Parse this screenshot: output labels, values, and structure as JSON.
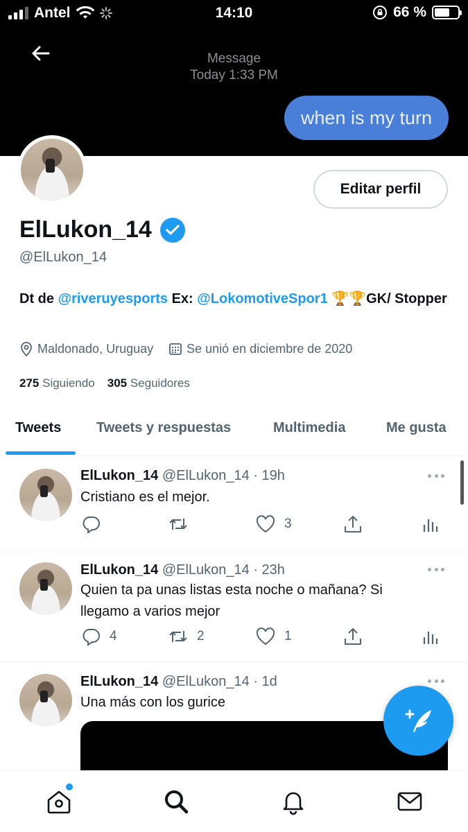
{
  "status_bar": {
    "carrier": "Antel",
    "time": "14:10",
    "battery": "66 %",
    "battery_level": 0.66
  },
  "banner": {
    "message_label": "Message",
    "message_time": "Today 1:33 PM",
    "bubble_text": "when is my turn"
  },
  "profile": {
    "edit_button": "Editar perfil",
    "display_name": "ElLukon_14",
    "handle": "@ElLukon_14",
    "bio_prefix": "Dt de ",
    "bio_mention1": "@riveruyesports",
    "bio_middle": " Ex: ",
    "bio_mention2": "@LokomotiveSpor1",
    "bio_suffix": " 🏆🏆GK/ Stopper",
    "location": "Maldonado, Uruguay",
    "joined": "Se unió en diciembre de 2020",
    "following_count": "275",
    "following_label": "Siguiendo",
    "followers_count": "305",
    "followers_label": "Seguidores"
  },
  "tabs": [
    "Tweets",
    "Tweets y respuestas",
    "Multimedia",
    "Me gusta"
  ],
  "tweets": [
    {
      "name": "ElLukon_14",
      "meta": "@ElLukon_14 · 19h",
      "text": "Cristiano es el mejor.",
      "replies": "",
      "retweets": "",
      "likes": "3"
    },
    {
      "name": "ElLukon_14",
      "meta": "@ElLukon_14 · 23h",
      "text": "Quien ta pa unas listas esta noche o mañana? Si llegamo a varios mejor",
      "replies": "4",
      "retweets": "2",
      "likes": "1"
    },
    {
      "name": "ElLukon_14",
      "meta": "@ElLukon_14 · 1d",
      "text": "Una más con los gurice"
    }
  ],
  "colors": {
    "accent": "#1d9bf0",
    "text": "#0f1419",
    "muted": "#536471",
    "bubble": "#4a7fd9"
  },
  "icons": {
    "compose": "compose-tweet-icon",
    "nav": [
      "home-icon",
      "search-icon",
      "bell-icon",
      "mail-icon"
    ]
  }
}
